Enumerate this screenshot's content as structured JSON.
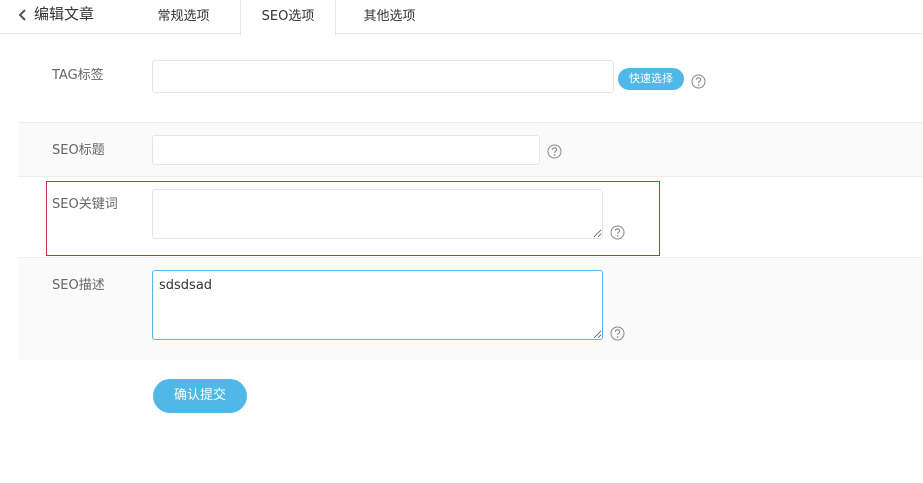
{
  "header": {
    "back_title": "编辑文章",
    "tabs": [
      {
        "label": "常规选项"
      },
      {
        "label": "SEO选项",
        "active": true
      },
      {
        "label": "其他选项"
      }
    ]
  },
  "form": {
    "tag": {
      "label": "TAG标签",
      "value": "",
      "quick_select_label": "快速选择"
    },
    "seo_title": {
      "label": "SEO标题",
      "value": ""
    },
    "seo_keywords": {
      "label": "SEO关键词",
      "value": ""
    },
    "seo_description": {
      "label": "SEO描述",
      "value": "sdsdsad"
    },
    "submit_label": "确认提交"
  },
  "colors": {
    "accent": "#4fb8e6",
    "highlight_border": "#cc3333",
    "active_input_border": "#5bb5e8"
  },
  "icons": {
    "back": "chevron-left-icon",
    "help": "question-circle-icon"
  }
}
